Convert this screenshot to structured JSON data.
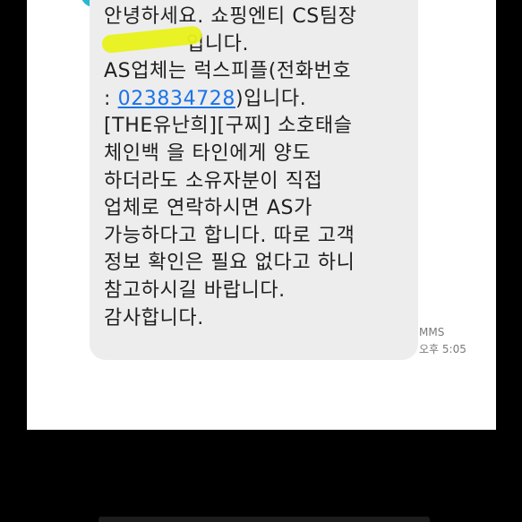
{
  "colors": {
    "backdrop": "#000000",
    "screen": "#ffffff",
    "bubble": "#ededed",
    "text": "#1f1f1f",
    "link": "#1a73e8",
    "meta": "#7a7a7a",
    "highlight": "#e8f21a",
    "avatar": "#2ab8d0"
  },
  "conversation": {
    "message": {
      "lines": [
        "안녕하세요. 쇼핑엔티 CS팀장",
        "입니다.",
        "AS업체는 럭스피플(전화번호",
        "023834728",
        "[THE유난희][구찌] 소호태슬",
        "체인백 을 타인에게 양도",
        "하더라도 소유자분이 직접",
        "업체로 연락하시면 AS가",
        "가능하다고 합니다. 따로 고객",
        "정보 확인은 필요 없다고 하니",
        "참고하시길 바랍니다.",
        "감사합니다."
      ],
      "line4_prefix": ": ",
      "line4_suffix": ")입니다."
    },
    "meta": {
      "type": "MMS",
      "time": "오후 5:05"
    }
  }
}
